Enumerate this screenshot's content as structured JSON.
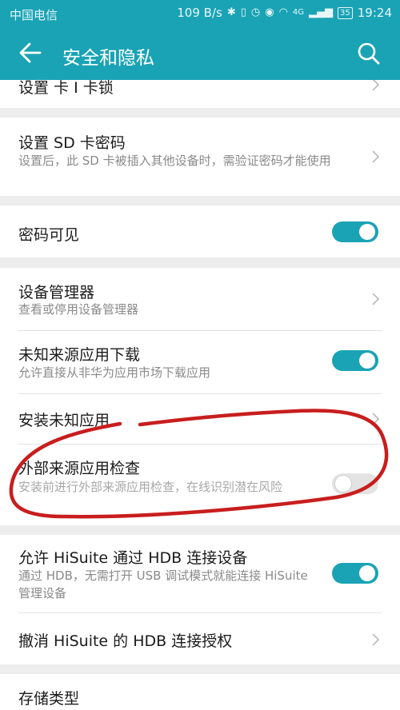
{
  "status_bar": {
    "carrier": "中国电信",
    "speed": "109 B/s",
    "signal": "4G",
    "battery": "35",
    "time": "19:24"
  },
  "app_bar": {
    "title": "安全和隐私"
  },
  "settings": {
    "sim_lock": {
      "title": "设置 卡 I 卡锁"
    },
    "sd_password": {
      "title": "设置 SD 卡密码",
      "subtitle": "设置后，此 SD 卡被插入其他设备时，需验证密码才能使用"
    },
    "password_visible": {
      "title": "密码可见",
      "enabled": true
    },
    "device_manager": {
      "title": "设备管理器",
      "subtitle": "查看或停用设备管理器"
    },
    "unknown_source_download": {
      "title": "未知来源应用下载",
      "subtitle": "允许直接从非华为应用市场下载应用",
      "enabled": true
    },
    "install_unknown_apps": {
      "title": "安装未知应用"
    },
    "external_source_check": {
      "title": "外部来源应用检查",
      "subtitle": "安装前进行外部来源应用检查，在线识别潜在风险",
      "enabled": false
    },
    "hisuite_hdb": {
      "title": "允许 HiSuite 通过 HDB 连接设备",
      "subtitle": "通过 HDB，无需打开 USB 调试模式就能连接 HiSuite 管理设备",
      "enabled": true
    },
    "revoke_hisuite": {
      "title": "撤消 HiSuite 的 HDB 连接授权"
    },
    "storage_type": {
      "title": "存储类型"
    }
  },
  "colors": {
    "accent": "#1aa3b5",
    "annotation": "#c81e1e"
  }
}
